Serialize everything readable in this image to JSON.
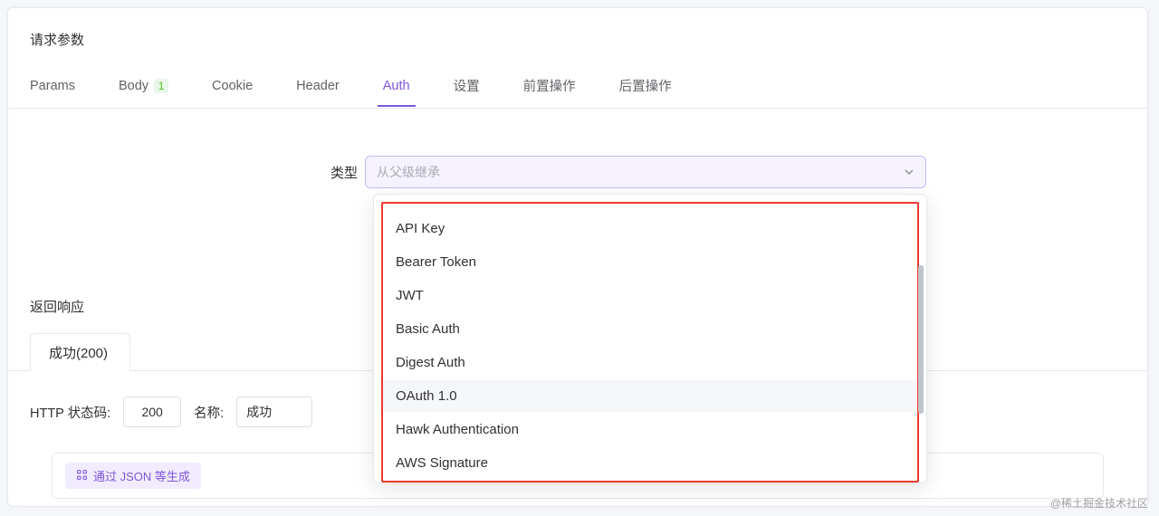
{
  "section_title": "请求参数",
  "tabs": [
    {
      "label": "Params",
      "badge": null,
      "active": false
    },
    {
      "label": "Body",
      "badge": "1",
      "active": false
    },
    {
      "label": "Cookie",
      "badge": null,
      "active": false
    },
    {
      "label": "Header",
      "badge": null,
      "active": false
    },
    {
      "label": "Auth",
      "badge": null,
      "active": true
    },
    {
      "label": "设置",
      "badge": null,
      "active": false
    },
    {
      "label": "前置操作",
      "badge": null,
      "active": false
    },
    {
      "label": "后置操作",
      "badge": null,
      "active": false
    }
  ],
  "auth": {
    "type_label": "类型",
    "select_placeholder": "从父级继承",
    "options": [
      "API Key",
      "Bearer Token",
      "JWT",
      "Basic Auth",
      "Digest Auth",
      "OAuth 1.0",
      "Hawk Authentication",
      "AWS Signature"
    ],
    "hover_index": 5
  },
  "response": {
    "section_title": "返回响应",
    "active_tab": "成功(200)",
    "status_label": "HTTP 状态码:",
    "status_value": "200",
    "name_label": "名称:",
    "name_value": "成功",
    "json_gen_label": "通过 JSON 等生成"
  },
  "watermark": "@稀土掘金技术社区"
}
